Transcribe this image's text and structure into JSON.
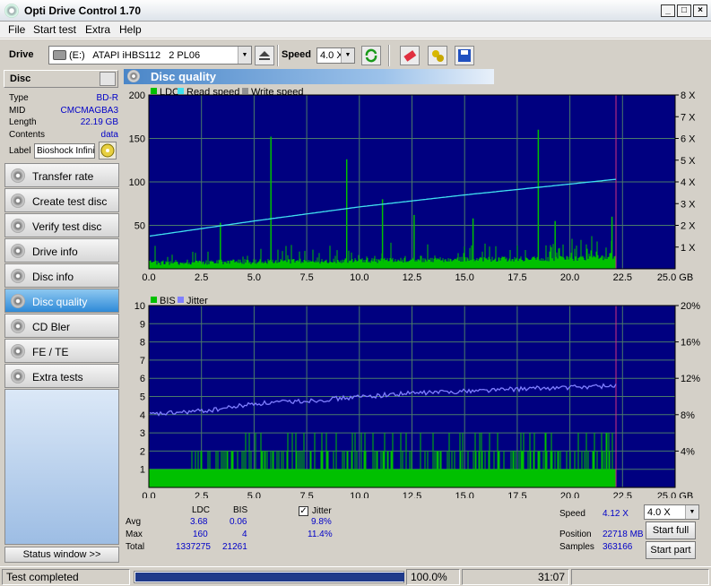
{
  "window": {
    "title": "Opti Drive Control 1.70"
  },
  "menu": [
    "File",
    "Start test",
    "Extra",
    "Help"
  ],
  "toolbar": {
    "drive_label": "Drive",
    "drive_value": "(E:)   ATAPI iHBS112   2 PL06",
    "speed_label": "Speed",
    "speed_value": "4.0 X"
  },
  "disc": {
    "header": "Disc",
    "type_label": "Type",
    "type_value": "BD-R",
    "mid_label": "MID",
    "mid_value": "CMCMAGBA3",
    "length_label": "Length",
    "length_value": "22.19 GB",
    "contents_label": "Contents",
    "contents_value": "data",
    "label_label": "Label",
    "label_value": "Bioshock Infini"
  },
  "nav": [
    {
      "label": "Transfer rate",
      "active": false
    },
    {
      "label": "Create test disc",
      "active": false
    },
    {
      "label": "Verify test disc",
      "active": false
    },
    {
      "label": "Drive info",
      "active": false
    },
    {
      "label": "Disc info",
      "active": false
    },
    {
      "label": "Disc quality",
      "active": true
    },
    {
      "label": "CD Bler",
      "active": false
    },
    {
      "label": "FE / TE",
      "active": false
    },
    {
      "label": "Extra tests",
      "active": false
    }
  ],
  "status_window_label": "Status window >>",
  "panel_title": "Disc quality",
  "chart_data": [
    {
      "type": "bar",
      "legend": [
        "LDC",
        "Read speed",
        "Write speed"
      ],
      "colors": {
        "LDC": "#00c000",
        "Read speed": "#40e0f0",
        "Write speed": "#909090",
        "background": "#000080"
      },
      "x_ticks": [
        "0.0",
        "2.5",
        "5.0",
        "7.5",
        "10.0",
        "12.5",
        "15.0",
        "17.5",
        "20.0",
        "22.5",
        "25.0 GB"
      ],
      "y_ticks_left": [
        "50",
        "100",
        "150",
        "200"
      ],
      "y_ticks_right": [
        "1 X",
        "2 X",
        "3 X",
        "4 X",
        "5 X",
        "6 X",
        "7 X",
        "8 X"
      ],
      "xlim": [
        0,
        25
      ],
      "ylim": [
        0,
        200
      ],
      "y2lim": [
        0,
        8
      ],
      "disc_end_gb": 22.19,
      "ldc_spikes": [
        {
          "x": 5.8,
          "y": 152
        },
        {
          "x": 9.4,
          "y": 126
        },
        {
          "x": 11.1,
          "y": 80
        },
        {
          "x": 18.5,
          "y": 160
        },
        {
          "x": 3.4,
          "y": 53
        },
        {
          "x": 12.6,
          "y": 62
        },
        {
          "x": 15.4,
          "y": 58
        },
        {
          "x": 19.3,
          "y": 55
        },
        {
          "x": 22.0,
          "y": 60
        }
      ],
      "read_speed": [
        {
          "x": 0,
          "y": 1.5
        },
        {
          "x": 5,
          "y": 2.2
        },
        {
          "x": 10,
          "y": 2.85
        },
        {
          "x": 15,
          "y": 3.4
        },
        {
          "x": 20,
          "y": 3.9
        },
        {
          "x": 22.19,
          "y": 4.12
        }
      ]
    },
    {
      "type": "bar",
      "legend": [
        "BIS",
        "Jitter"
      ],
      "colors": {
        "BIS": "#00c000",
        "Jitter": "#8080ff",
        "background": "#000080"
      },
      "x_ticks": [
        "0.0",
        "2.5",
        "5.0",
        "7.5",
        "10.0",
        "12.5",
        "15.0",
        "17.5",
        "20.0",
        "22.5",
        "25.0 GB"
      ],
      "y_ticks_left": [
        "1",
        "2",
        "3",
        "4",
        "5",
        "6",
        "7",
        "8",
        "9",
        "10"
      ],
      "y_ticks_right": [
        "4%",
        "8%",
        "12%",
        "16%",
        "20%"
      ],
      "xlim": [
        0,
        25
      ],
      "ylim": [
        0,
        10
      ],
      "y2lim": [
        0,
        20
      ],
      "disc_end_gb": 22.19,
      "bis_base": 1,
      "jitter": [
        {
          "x": 0,
          "y": 8.0
        },
        {
          "x": 3,
          "y": 8.5
        },
        {
          "x": 5,
          "y": 9.2
        },
        {
          "x": 8,
          "y": 9.6
        },
        {
          "x": 12,
          "y": 10.3
        },
        {
          "x": 16,
          "y": 10.7
        },
        {
          "x": 20,
          "y": 11.0
        },
        {
          "x": 22.19,
          "y": 11.2
        }
      ]
    }
  ],
  "stats": {
    "col_ldc": "LDC",
    "col_bis": "BIS",
    "avg_label": "Avg",
    "avg_ldc": "3.68",
    "avg_bis": "0.06",
    "max_label": "Max",
    "max_ldc": "160",
    "max_bis": "4",
    "total_label": "Total",
    "total_ldc": "1337275",
    "total_bis": "21261",
    "jitter_label": "Jitter",
    "jitter_avg": "9.8%",
    "jitter_max": "11.4%",
    "speed_label": "Speed",
    "speed_value": "4.12 X",
    "speed_select": "4.0 X",
    "position_label": "Position",
    "position_value": "22718 MB",
    "samples_label": "Samples",
    "samples_value": "363166",
    "start_full": "Start full",
    "start_part": "Start part"
  },
  "statusbar": {
    "text": "Test completed",
    "progress": 1.0,
    "percent": "100.0%",
    "time": "31:07"
  }
}
